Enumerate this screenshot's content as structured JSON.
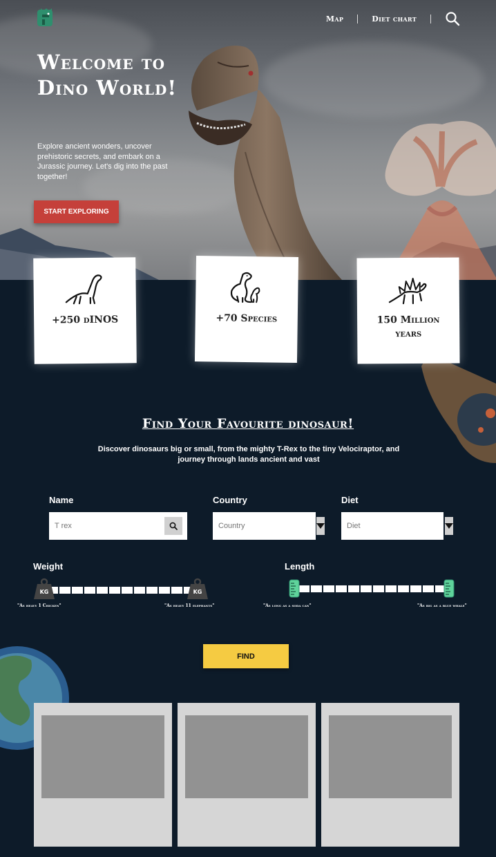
{
  "nav": {
    "items": [
      {
        "label": "Map"
      },
      {
        "label": "Diet chart"
      }
    ]
  },
  "hero": {
    "title": "Welcome to Dino World!",
    "text": "Explore ancient wonders, uncover prehistoric secrets, and embark on a Jurassic journey. Let's dig into the past together!",
    "button": "START EXPLORING"
  },
  "stats": [
    {
      "label": "+250 dINOS",
      "icon": "brachiosaurus-icon"
    },
    {
      "label": "+70 Species",
      "icon": "dino-family-icon"
    },
    {
      "label": "150 Million years",
      "icon": "stegosaurus-icon"
    }
  ],
  "search": {
    "title": "Find Your Favourite dinosaur!",
    "description": "Discover dinosaurs big or small, from the mighty T-Rex to the tiny Velociraptor, and journey through lands ancient and vast",
    "name_label": "Name",
    "name_placeholder": "T rex",
    "country_label": "Country",
    "country_placeholder": "Country",
    "diet_label": "Diet",
    "diet_placeholder": "Diet",
    "weight_label": "Weight",
    "weight_min_caption": "\"As heavy 1 Chicken\"",
    "weight_max_caption": "\"As heavy 11 elephants\"",
    "weight_knob_text": "KG",
    "length_label": "Length",
    "length_min_caption": "\"As long as a soda can\"",
    "length_max_caption": "\"As big as a blue whale\"",
    "find_button": "FIND"
  },
  "colors": {
    "background": "#0d1b29",
    "accent_red": "#c5403a",
    "accent_yellow": "#f5cb42",
    "ruler_green": "#5fd39b",
    "logo_green": "#2e8f6e"
  }
}
